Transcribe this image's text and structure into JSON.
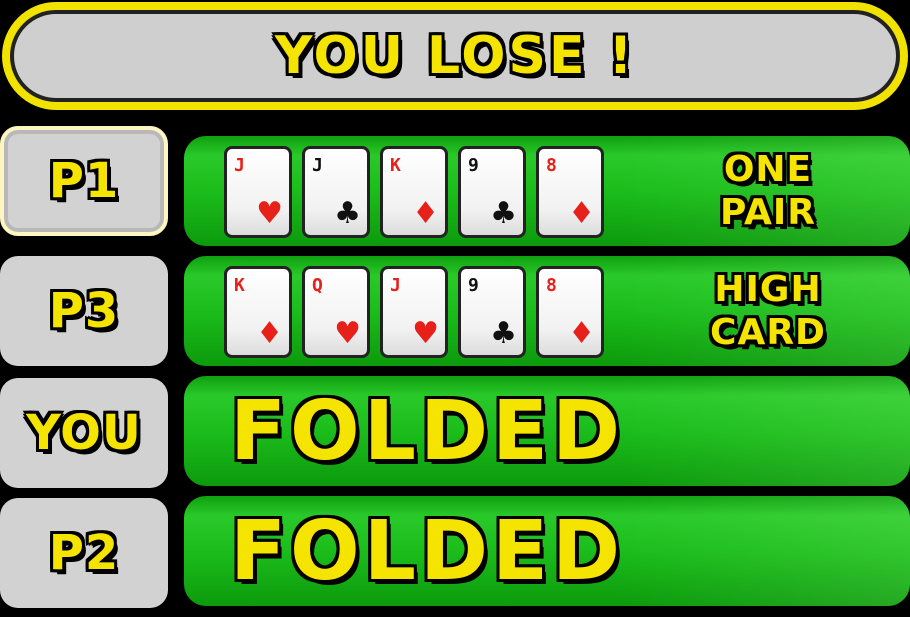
{
  "banner": {
    "text": "YOU LOSE !"
  },
  "rows": [
    {
      "player": "P1",
      "cards": [
        {
          "rank": "J",
          "suit": "♥",
          "color": "#e8201a"
        },
        {
          "rank": "J",
          "suit": "♣",
          "color": "#111111"
        },
        {
          "rank": "K",
          "suit": "♦",
          "color": "#e8201a"
        },
        {
          "rank": "9",
          "suit": "♣",
          "color": "#111111"
        },
        {
          "rank": "8",
          "suit": "♦",
          "color": "#e8201a"
        }
      ],
      "hand_line1": "ONE",
      "hand_line2": "PAIR"
    },
    {
      "player": "P3",
      "cards": [
        {
          "rank": "K",
          "suit": "♦",
          "color": "#e8201a"
        },
        {
          "rank": "Q",
          "suit": "♥",
          "color": "#e8201a"
        },
        {
          "rank": "J",
          "suit": "♥",
          "color": "#e8201a"
        },
        {
          "rank": "9",
          "suit": "♣",
          "color": "#111111"
        },
        {
          "rank": "8",
          "suit": "♦",
          "color": "#e8201a"
        }
      ],
      "hand_line1": "HIGH",
      "hand_line2": "CARD"
    },
    {
      "player": "YOU",
      "status": "FOLDED"
    },
    {
      "player": "P2",
      "status": "FOLDED"
    }
  ],
  "colors": {
    "title_yellow": "#f5e400",
    "panel_green": "#1bbd1b",
    "label_gray": "#d2d2d2",
    "red_suit": "#e8201a",
    "black_suit": "#111111"
  }
}
